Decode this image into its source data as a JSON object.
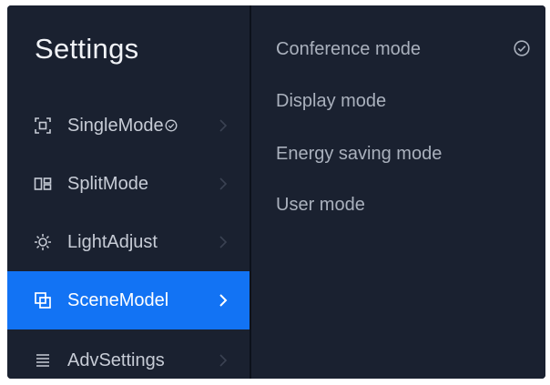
{
  "sidebar": {
    "title": "Settings",
    "items": [
      {
        "label": "SingleMode",
        "icon": "focus-frame-icon",
        "checked": true,
        "active": false
      },
      {
        "label": "SplitMode",
        "icon": "split-layout-icon",
        "checked": false,
        "active": false
      },
      {
        "label": "LightAdjust",
        "icon": "sun-icon",
        "checked": false,
        "active": false
      },
      {
        "label": "SceneModel",
        "icon": "layers-icon",
        "checked": false,
        "active": true
      },
      {
        "label": "AdvSettings",
        "icon": "list-settings-icon",
        "checked": false,
        "active": false
      }
    ]
  },
  "panel": {
    "options": [
      {
        "label": "Conference mode",
        "selected": true
      },
      {
        "label": "Display mode",
        "selected": false
      },
      {
        "label": "Energy saving mode",
        "selected": false
      },
      {
        "label": "User mode",
        "selected": false
      }
    ]
  },
  "colors": {
    "background": "#1a2130",
    "divider": "#0c111b",
    "accent": "#1273f4",
    "title": "#f1f3f7",
    "text": "#c7ccd6",
    "option_text": "#aab1bd",
    "chevron": "#3a4252"
  }
}
